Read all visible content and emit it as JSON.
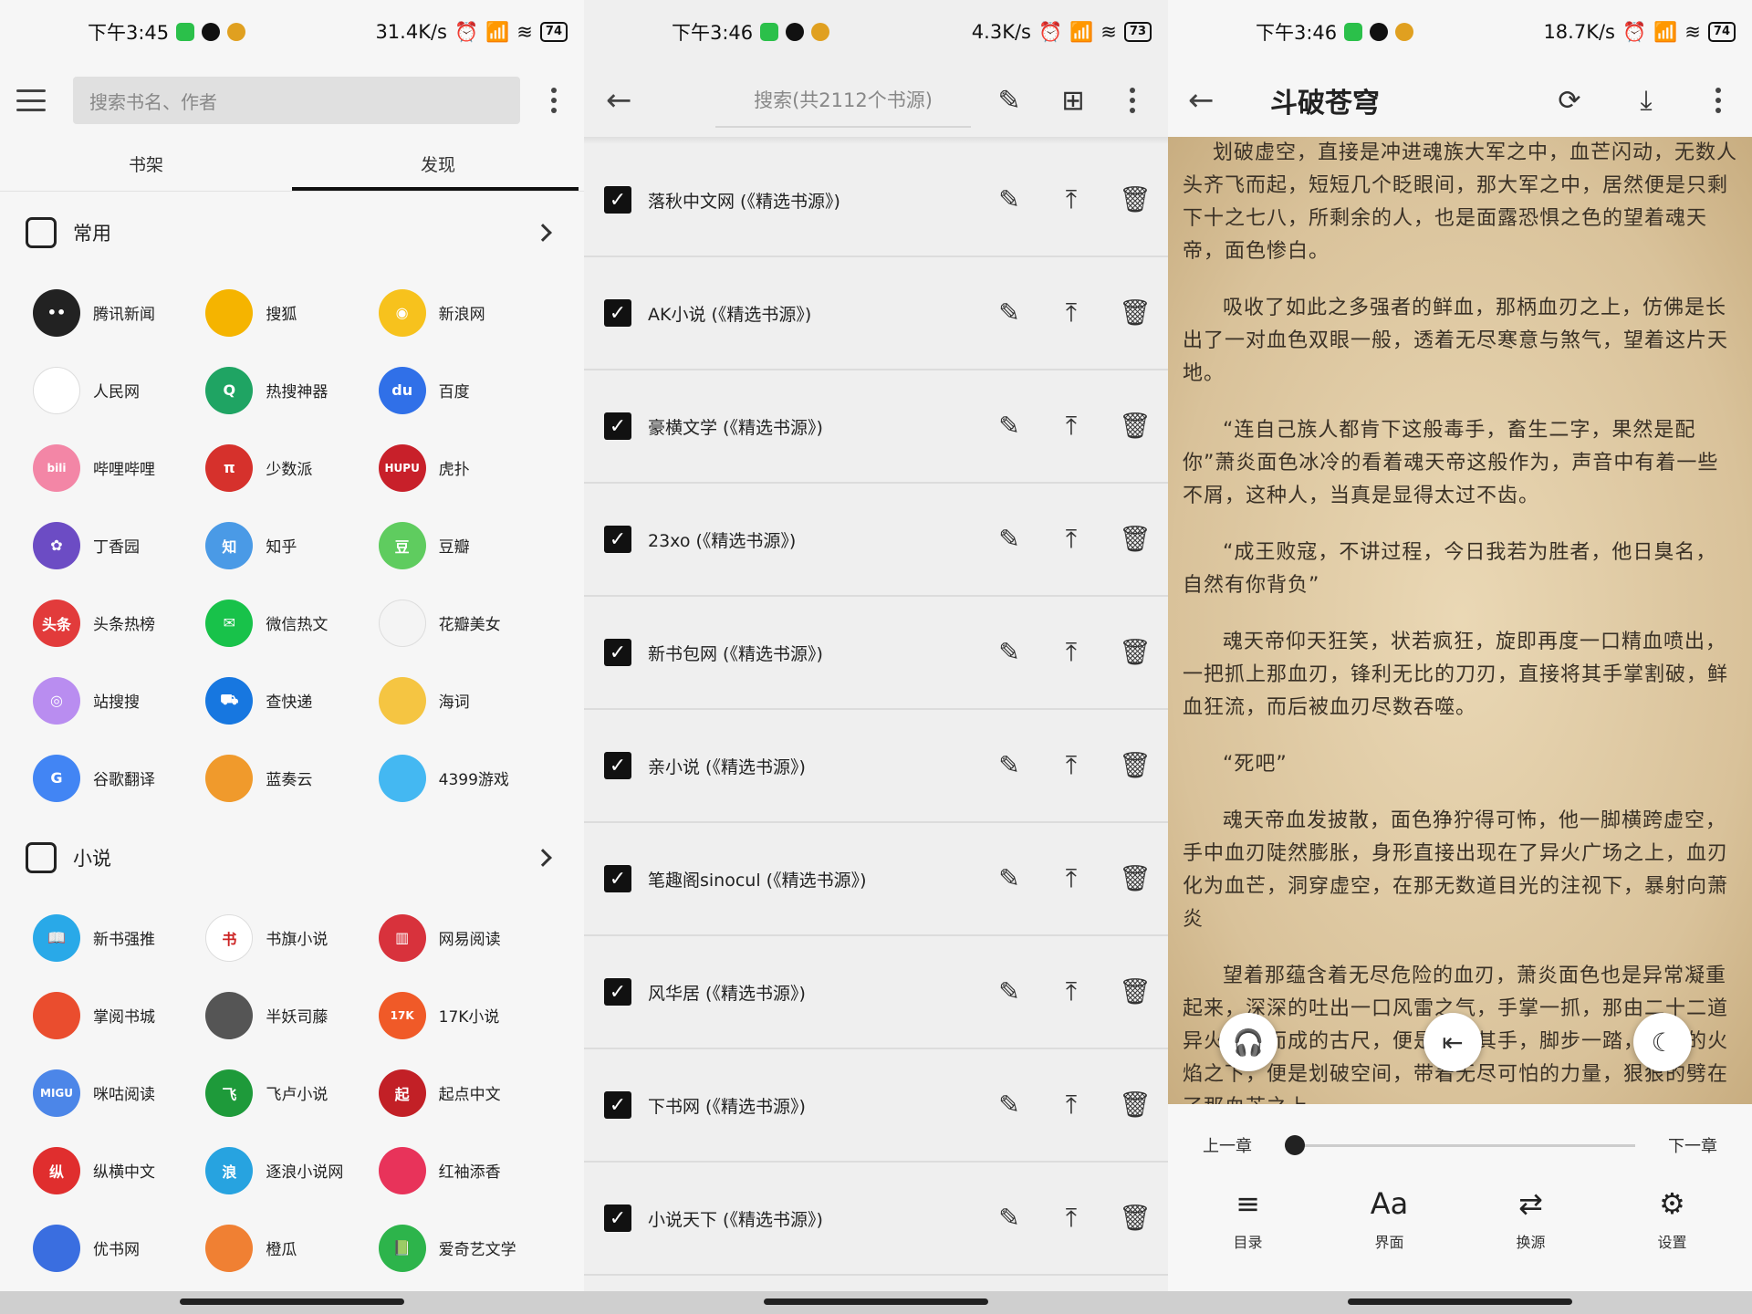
{
  "phone1": {
    "status": {
      "time": "下午3:45",
      "speed": "31.4K/s",
      "battery": "74"
    },
    "search_placeholder": "搜索书名、作者",
    "tabs": [
      "书架",
      "发现"
    ],
    "sections": [
      {
        "title": "常用",
        "apps": [
          {
            "name": "腾讯新闻",
            "color": "#222222",
            "glyph": "••"
          },
          {
            "name": "搜狐",
            "color": "#f5b400",
            "glyph": ""
          },
          {
            "name": "新浪网",
            "color": "#f7c21d",
            "glyph": "◉"
          },
          {
            "name": "人民网",
            "color": "#ffffff",
            "glyph": ""
          },
          {
            "name": "热搜神器",
            "color": "#1fa463",
            "glyph": "Q"
          },
          {
            "name": "百度",
            "color": "#3070e8",
            "glyph": "du"
          },
          {
            "name": "哔哩哔哩",
            "color": "#f386a6",
            "glyph": "bili"
          },
          {
            "name": "少数派",
            "color": "#d6312c",
            "glyph": "π"
          },
          {
            "name": "虎扑",
            "color": "#c8202a",
            "glyph": "HUPU"
          },
          {
            "name": "丁香园",
            "color": "#6c4cc4",
            "glyph": "✿"
          },
          {
            "name": "知乎",
            "color": "#4a9ae6",
            "glyph": "知"
          },
          {
            "name": "豆瓣",
            "color": "#5fcc5f",
            "glyph": "豆"
          },
          {
            "name": "头条热榜",
            "color": "#e23b3b",
            "glyph": "头条"
          },
          {
            "name": "微信热文",
            "color": "#18c24a",
            "glyph": "✉"
          },
          {
            "name": "花瓣美女",
            "color": "#f4f4f4",
            "glyph": ""
          },
          {
            "name": "站搜搜",
            "color": "#b98df0",
            "glyph": "◎"
          },
          {
            "name": "查快递",
            "color": "#1777e0",
            "glyph": "⛟"
          },
          {
            "name": "海词",
            "color": "#f5c542",
            "glyph": ""
          },
          {
            "name": "谷歌翻译",
            "color": "#4285f4",
            "glyph": "G"
          },
          {
            "name": "蓝奏云",
            "color": "#f09a2c",
            "glyph": ""
          },
          {
            "name": "4399游戏",
            "color": "#44b8f2",
            "glyph": ""
          }
        ]
      },
      {
        "title": "小说",
        "apps": [
          {
            "name": "新书强推",
            "color": "#29a9e8",
            "glyph": "📖"
          },
          {
            "name": "书旗小说",
            "color": "#ffffff",
            "glyph": "书"
          },
          {
            "name": "网易阅读",
            "color": "#d8323c",
            "glyph": "▥"
          },
          {
            "name": "掌阅书城",
            "color": "#ea4d2e",
            "glyph": ""
          },
          {
            "name": "半妖司藤",
            "color": "#555555",
            "glyph": ""
          },
          {
            "name": "17K小说",
            "color": "#f05a28",
            "glyph": "17K"
          },
          {
            "name": "咪咕阅读",
            "color": "#4c86e8",
            "glyph": "MIGU"
          },
          {
            "name": "飞卢小说",
            "color": "#1e9a3a",
            "glyph": "飞"
          },
          {
            "name": "起点中文",
            "color": "#c22026",
            "glyph": "起"
          },
          {
            "name": "纵横中文",
            "color": "#e02e2e",
            "glyph": "纵"
          },
          {
            "name": "逐浪小说网",
            "color": "#27a3e0",
            "glyph": "浪"
          },
          {
            "name": "红袖添香",
            "color": "#e8335a",
            "glyph": ""
          },
          {
            "name": "优书网",
            "color": "#3a6ee0",
            "glyph": ""
          },
          {
            "name": "橙瓜",
            "color": "#f08033",
            "glyph": ""
          },
          {
            "name": "爱奇艺文学",
            "color": "#2db44b",
            "glyph": "📗"
          }
        ]
      }
    ]
  },
  "phone2": {
    "status": {
      "time": "下午3:46",
      "speed": "4.3K/s",
      "battery": "73"
    },
    "search_placeholder": "搜索(共2112个书源)",
    "sources": [
      "落秋中文网 (《精选书源》)",
      "AK小说 (《精选书源》)",
      "豪横文学 (《精选书源》)",
      "23xo (《精选书源》)",
      "新书包网 (《精选书源》)",
      "亲小说 (《精选书源》)",
      "笔趣阁sinocul (《精选书源》)",
      "风华居 (《精选书源》)",
      "下书网 (《精选书源》)",
      "小说天下 (《精选书源》)"
    ]
  },
  "phone3": {
    "status": {
      "time": "下午3:46",
      "speed": "18.7K/s",
      "battery": "74"
    },
    "book_title": "斗破苍穹",
    "paragraphs": [
      "划破虚空，直接是冲进魂族大军之中，血芒闪动，无数人头齐飞而起，短短几个眨眼间，那大军之中，居然便是只剩下十之七八，所剩余的人，也是面露恐惧之色的望着魂天帝，面色惨白。",
      "吸收了如此之多强者的鲜血，那柄血刃之上，仿佛是长出了一对血色双眼一般，透着无尽寒意与煞气，望着这片天地。",
      "“连自己族人都肯下这般毒手，畜生二字，果然是配你”萧炎面色冰冷的看着魂天帝这般作为，声音中有着一些不屑，这种人，当真是显得太过不齿。",
      "“成王败寇，不讲过程，今日我若为胜者，他日臭名，自然有你背负”",
      "魂天帝仰天狂笑，状若疯狂，旋即再度一口精血喷出，一把抓上那血刃，锋利无比的刀刃，直接将其手掌割破，鲜血狂流，而后被血刃尽数吞噬。",
      "“死吧”",
      "魂天帝血发披散，面色狰狞得可怖，他一脚横跨虚空，手中血刃陡然膨胀，身形直接出现在了异火广场之上，血刃化为血芒，洞穿虚空，在那无数道目光的注视下，暴射向萧炎",
      "望着那蕴含着无尽危险的血刃，萧炎面色也是异常凝重起来，深深的吐出一口风雷之气，手掌一抓，那由二十二道异火凝聚而成的古尺，便是落入其手，脚步一踏，绚丽的火焰之下，便是划破空间，带着无尽可怕的力量，狠狠的劈在了那血芒之上。"
    ],
    "prev_chapter": "上一章",
    "next_chapter": "下一章",
    "progress": 0,
    "menu": [
      {
        "icon": "≡",
        "label": "目录"
      },
      {
        "icon": "Aa",
        "label": "界面"
      },
      {
        "icon": "⇄",
        "label": "换源"
      },
      {
        "icon": "⚙",
        "label": "设置"
      }
    ]
  }
}
